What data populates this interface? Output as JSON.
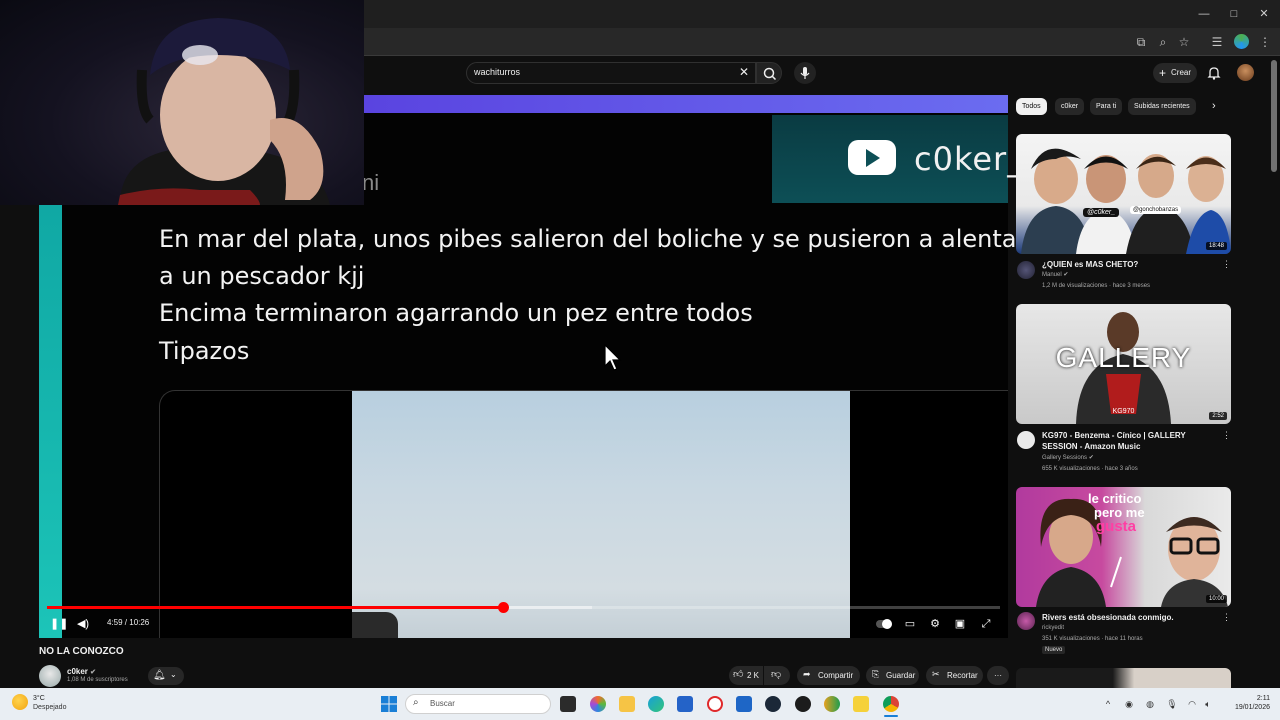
{
  "browser": {
    "window_controls": [
      "—",
      "□",
      "✕"
    ]
  },
  "youtube": {
    "search": {
      "value": "wachiturros"
    },
    "create_label": "Crear"
  },
  "player": {
    "yt_banner_name": "c0ker_",
    "partial_text": "ni",
    "tweet_lines": [
      "En mar del plata, unos pibes salieron del boliche y se pusieron a alentar",
      "a un pescador kjj",
      "Encima terminaron agarrando un pez entre todos",
      "Tipazos"
    ],
    "time_label": "4:59 / 10:26",
    "progress_fraction": 0.478,
    "buffered_fraction": 0.572
  },
  "video": {
    "title": "NO LA CONOZCO",
    "channel": "c0ker",
    "subscribers": "1,08 M de suscriptores",
    "likes": "2 K",
    "share_label": "Compartir",
    "save_label": "Guardar",
    "clip_label": "Recortar"
  },
  "chips": [
    "Todos",
    "c0ker",
    "Para ti",
    "Subidas recientes"
  ],
  "recommendations": [
    {
      "title": "¿QUIEN es MAS CHETO?",
      "channel": "Manuel",
      "meta": "1,2 M de visualizaciones · hace 3 meses",
      "duration": "18:48",
      "thumb_tags": [
        "@c0ker_",
        "@gonchobanzas"
      ],
      "title_lines": 1
    },
    {
      "title": "KG970 - Benzema - Cínico | GALLERY SESSION - Amazon Music",
      "channel": "Gallery Sessions",
      "meta": "655 K visualizaciones · hace 3 años",
      "duration": "2:52",
      "thumb_text": "GALLERY",
      "thumb_sub": "KG970",
      "title_lines": 2
    },
    {
      "title": "Rivers está obsesionada conmigo.",
      "channel": "rickyedit",
      "meta": "351 K visualizaciones · hace 11 horas",
      "badge": "Nuevo",
      "duration": "10:00",
      "thumb_text_1": "le critico",
      "thumb_text_2": "pero me",
      "thumb_text_3": "gusta",
      "title_lines": 1
    }
  ],
  "taskbar": {
    "weather_temp": "3°C",
    "weather_desc": "Despejado",
    "search_placeholder": "Buscar",
    "time": "2:11",
    "date": "19/01/2026"
  },
  "colors": {
    "yt_red": "#ff0000",
    "teal": "#14b5ad",
    "purple": "#5c49e3"
  }
}
